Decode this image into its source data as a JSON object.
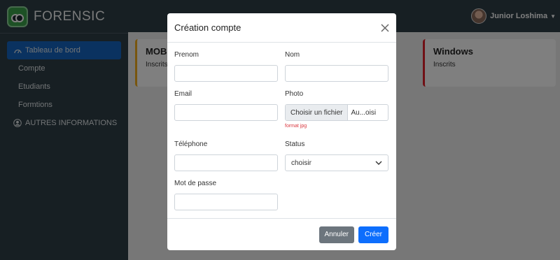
{
  "brand": {
    "name": "FORENSIC"
  },
  "sidebar": {
    "items": [
      {
        "label": "Tableau de bord",
        "icon": "dashboard-icon"
      },
      {
        "label": "Compte"
      },
      {
        "label": "Etudiants"
      },
      {
        "label": "Formtions"
      },
      {
        "label": "AUTRES INFORMATIONS",
        "icon": "user-circle-icon"
      }
    ]
  },
  "topbar": {
    "user_name": "Junior Loshima"
  },
  "cards": [
    {
      "title": "MOB",
      "subtitle": "Inscrits",
      "color": "#f0ad1e"
    },
    {
      "title": "Windows",
      "subtitle": "Inscrits",
      "color": "#e0202a"
    }
  ],
  "modal": {
    "title": "Création compte",
    "fields": {
      "prenom": {
        "label": "Prenom",
        "value": ""
      },
      "nom": {
        "label": "Nom",
        "value": ""
      },
      "email": {
        "label": "Email",
        "value": ""
      },
      "photo": {
        "label": "Photo",
        "button": "Choisir un fichier",
        "filename": "Au...oisi",
        "hint": "format jpg"
      },
      "telephone": {
        "label": "Téléphone",
        "value": ""
      },
      "status": {
        "label": "Status",
        "selected": "choisir"
      },
      "password": {
        "label": "Mot de passe",
        "value": ""
      }
    },
    "buttons": {
      "cancel": "Annuler",
      "create": "Créer"
    }
  },
  "colors": {
    "sidebar_bg": "#2f3e47",
    "active_item": "#1565c0",
    "primary": "#0d6efd",
    "secondary": "#6c757d"
  }
}
